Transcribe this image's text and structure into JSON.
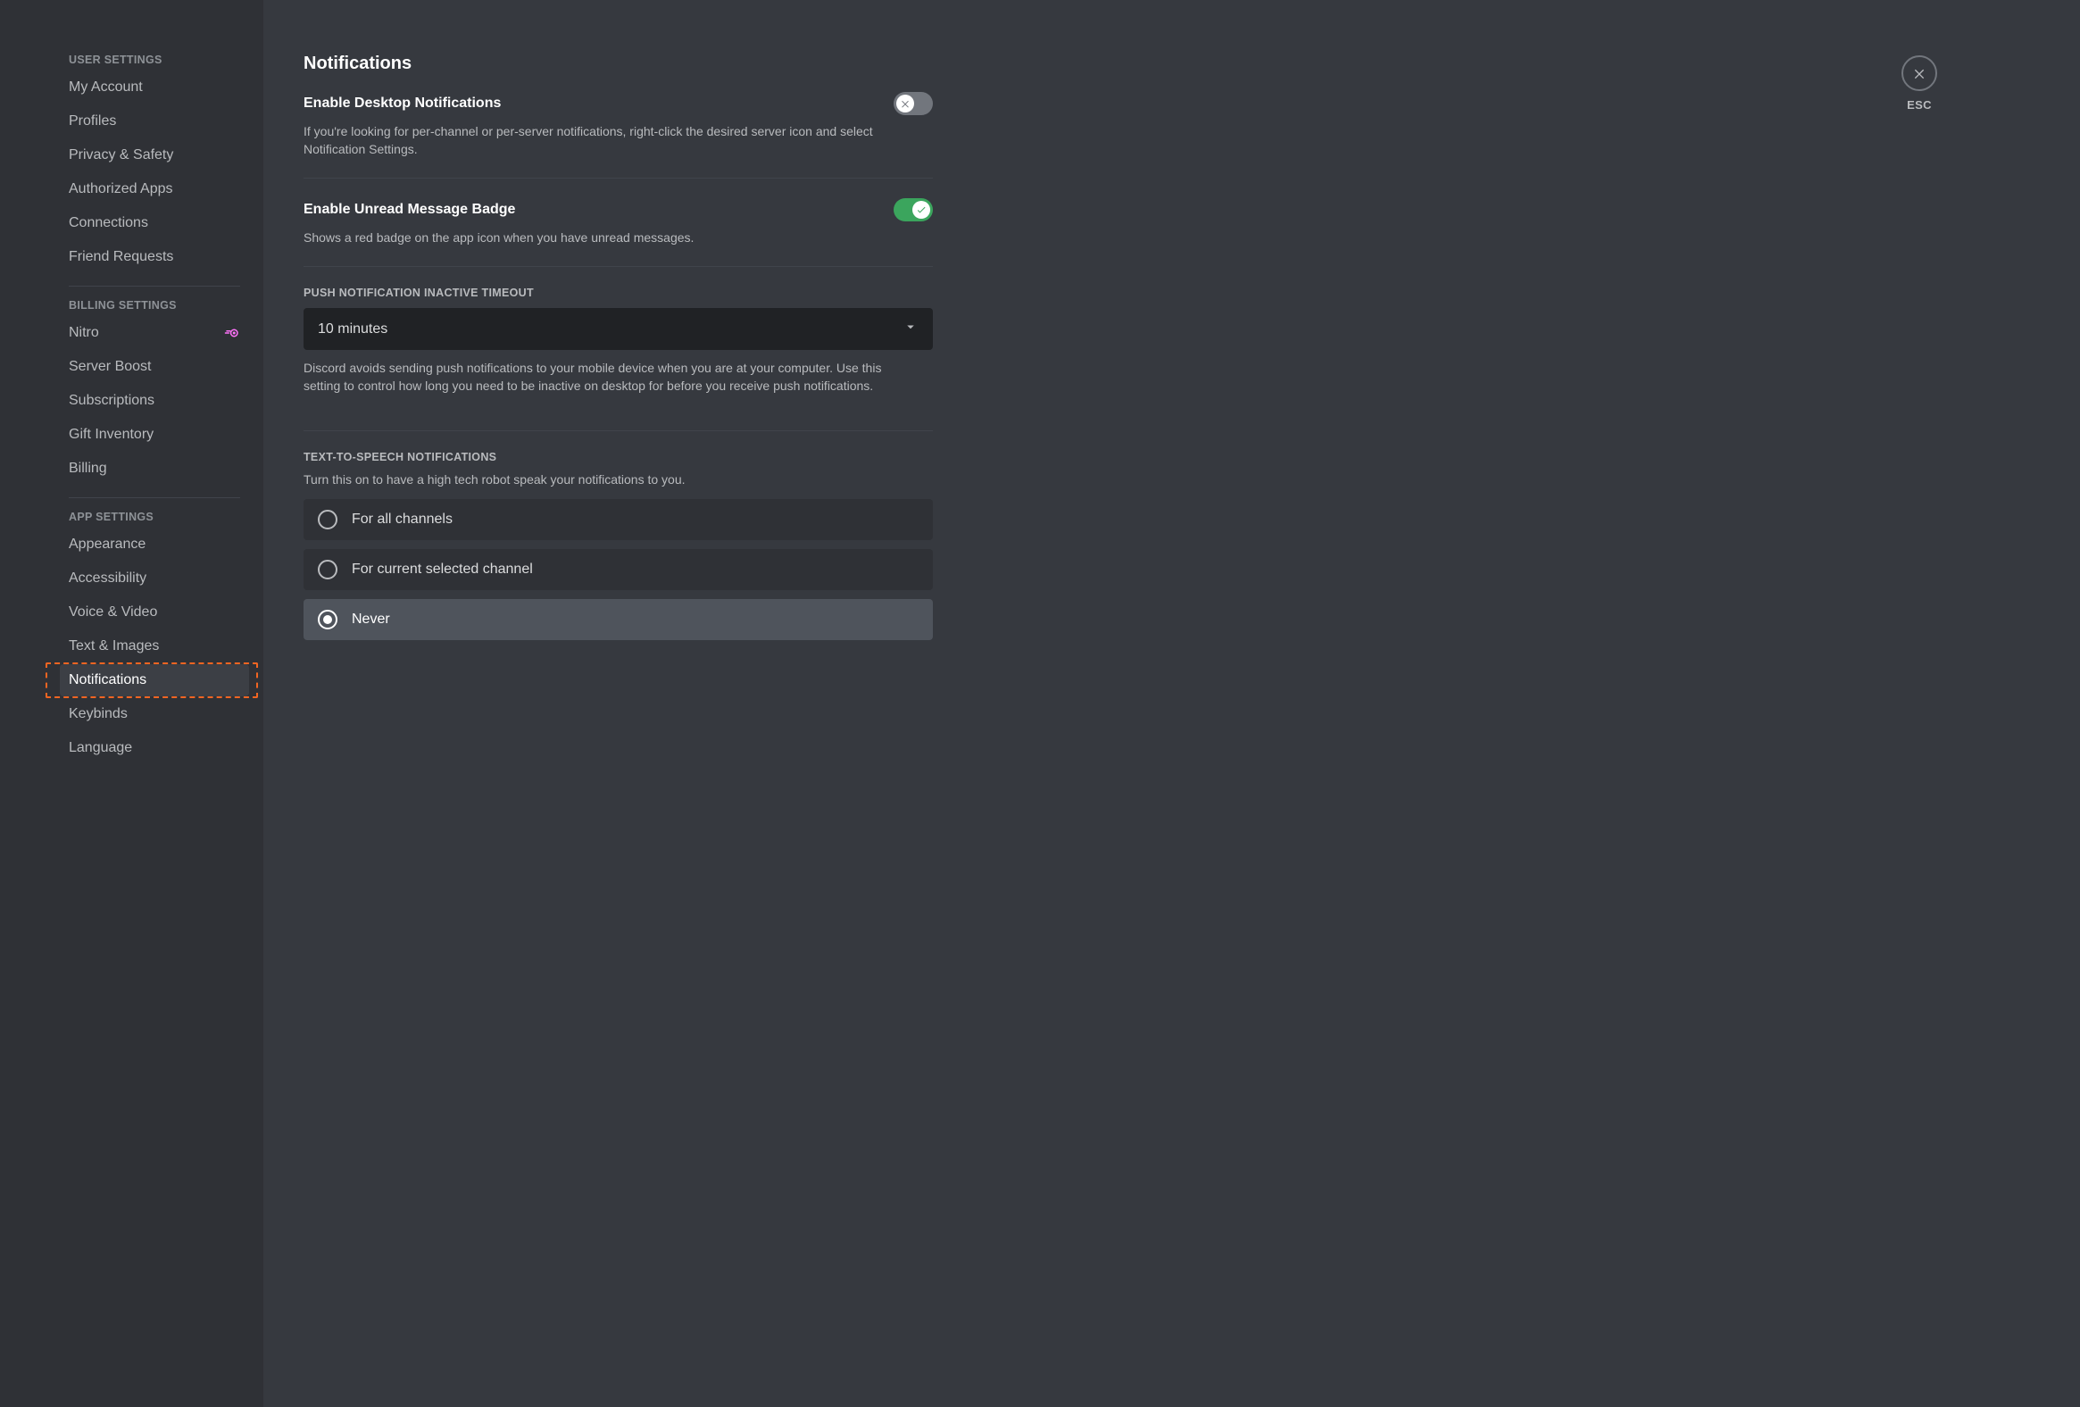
{
  "close": {
    "esc": "ESC"
  },
  "sidebar": {
    "groups": [
      {
        "header": "USER SETTINGS",
        "items": [
          {
            "label": "My Account",
            "selected": false,
            "badge": null
          },
          {
            "label": "Profiles",
            "selected": false,
            "badge": null
          },
          {
            "label": "Privacy & Safety",
            "selected": false,
            "badge": null
          },
          {
            "label": "Authorized Apps",
            "selected": false,
            "badge": null
          },
          {
            "label": "Connections",
            "selected": false,
            "badge": null
          },
          {
            "label": "Friend Requests",
            "selected": false,
            "badge": null
          }
        ]
      },
      {
        "header": "BILLING SETTINGS",
        "items": [
          {
            "label": "Nitro",
            "selected": false,
            "badge": "nitro"
          },
          {
            "label": "Server Boost",
            "selected": false,
            "badge": null
          },
          {
            "label": "Subscriptions",
            "selected": false,
            "badge": null
          },
          {
            "label": "Gift Inventory",
            "selected": false,
            "badge": null
          },
          {
            "label": "Billing",
            "selected": false,
            "badge": null
          }
        ]
      },
      {
        "header": "APP SETTINGS",
        "items": [
          {
            "label": "Appearance",
            "selected": false,
            "badge": null
          },
          {
            "label": "Accessibility",
            "selected": false,
            "badge": null
          },
          {
            "label": "Voice & Video",
            "selected": false,
            "badge": null
          },
          {
            "label": "Text & Images",
            "selected": false,
            "badge": null
          },
          {
            "label": "Notifications",
            "selected": true,
            "badge": null,
            "highlight": true
          },
          {
            "label": "Keybinds",
            "selected": false,
            "badge": null
          },
          {
            "label": "Language",
            "selected": false,
            "badge": null
          }
        ]
      }
    ]
  },
  "page": {
    "title": "Notifications",
    "desktop": {
      "title": "Enable Desktop Notifications",
      "desc": "If you're looking for per-channel or per-server notifications, right-click the desired server icon and select Notification Settings.",
      "enabled": false
    },
    "badge": {
      "title": "Enable Unread Message Badge",
      "desc": "Shows a red badge on the app icon when you have unread messages.",
      "enabled": true
    },
    "push": {
      "label": "PUSH NOTIFICATION INACTIVE TIMEOUT",
      "value": "10 minutes",
      "desc": "Discord avoids sending push notifications to your mobile device when you are at your computer. Use this setting to control how long you need to be inactive on desktop for before you receive push notifications."
    },
    "tts": {
      "label": "TEXT-TO-SPEECH NOTIFICATIONS",
      "sub": "Turn this on to have a high tech robot speak your notifications to you.",
      "options": [
        {
          "label": "For all channels",
          "selected": false
        },
        {
          "label": "For current selected channel",
          "selected": false
        },
        {
          "label": "Never",
          "selected": true
        }
      ]
    }
  }
}
